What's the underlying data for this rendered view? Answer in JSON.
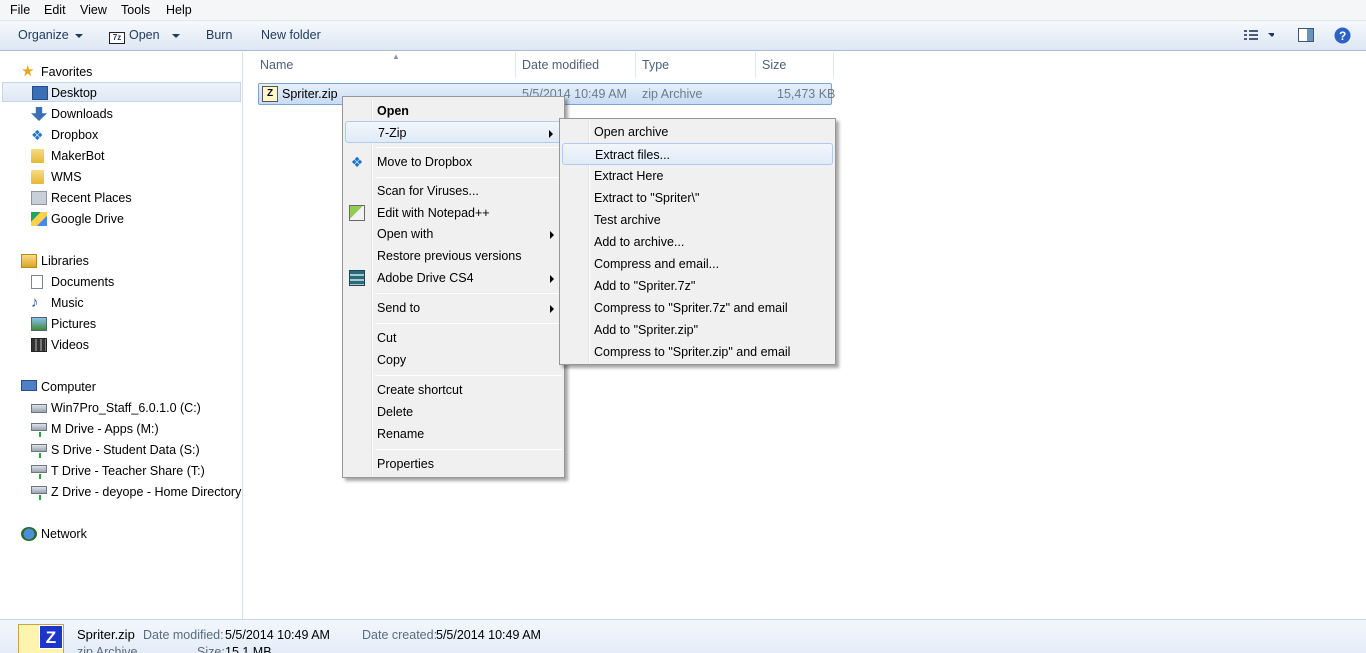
{
  "menubar": {
    "items": [
      "File",
      "Edit",
      "View",
      "Tools",
      "Help"
    ]
  },
  "toolbar": {
    "organize": "Organize",
    "open_badge": "7z",
    "open": "Open",
    "burn": "Burn",
    "new_folder": "New folder"
  },
  "nav": {
    "favorites": "Favorites",
    "desktop": "Desktop",
    "downloads": "Downloads",
    "dropbox": "Dropbox",
    "makerbot": "MakerBot",
    "wms": "WMS",
    "recent_places": "Recent Places",
    "google_drive": "Google Drive",
    "libraries": "Libraries",
    "documents": "Documents",
    "music": "Music",
    "pictures": "Pictures",
    "videos": "Videos",
    "computer": "Computer",
    "drive_c": "Win7Pro_Staff_6.0.1.0 (C:)",
    "drive_m": "M Drive - Apps (M:)",
    "drive_s": "S Drive - Student Data (S:)",
    "drive_t": "T Drive - Teacher Share (T:)",
    "drive_z": "Z Drive - deyope - Home Directory (Z:)",
    "network": "Network"
  },
  "columns": {
    "name": "Name",
    "date_modified": "Date modified",
    "type": "Type",
    "size": "Size"
  },
  "file": {
    "name": "Spriter.zip",
    "icon_letter": "Z",
    "date_modified": "5/5/2014 10:49 AM",
    "type": "zip Archive",
    "size": "15,473 KB"
  },
  "context_menu": {
    "open": "Open",
    "seven_zip": "7-Zip",
    "move_to_dropbox": "Move to Dropbox",
    "scan": "Scan for Viruses...",
    "edit_npp": "Edit with Notepad++",
    "open_with": "Open with",
    "restore": "Restore previous versions",
    "adobe_drive": "Adobe Drive CS4",
    "send_to": "Send to",
    "cut": "Cut",
    "copy": "Copy",
    "create_shortcut": "Create shortcut",
    "delete": "Delete",
    "rename": "Rename",
    "properties": "Properties"
  },
  "submenu": {
    "open_archive": "Open archive",
    "extract_files": "Extract files...",
    "extract_here": "Extract Here",
    "extract_to": "Extract to \"Spriter\\\"",
    "test_archive": "Test archive",
    "add_to_archive": "Add to archive...",
    "compress_email": "Compress and email...",
    "add_7z": "Add to \"Spriter.7z\"",
    "compress_7z_email": "Compress to \"Spriter.7z\" and email",
    "add_zip": "Add to \"Spriter.zip\"",
    "compress_zip_email": "Compress to \"Spriter.zip\" and email"
  },
  "details": {
    "name": "Spriter.zip",
    "icon_letter": "Z",
    "date_modified_label": "Date modified:",
    "date_modified": "5/5/2014 10:49 AM",
    "date_created_label": "Date created:",
    "date_created": "5/5/2014 10:49 AM",
    "type": "zip Archive",
    "size_label": "Size:",
    "size": "15.1 MB"
  }
}
